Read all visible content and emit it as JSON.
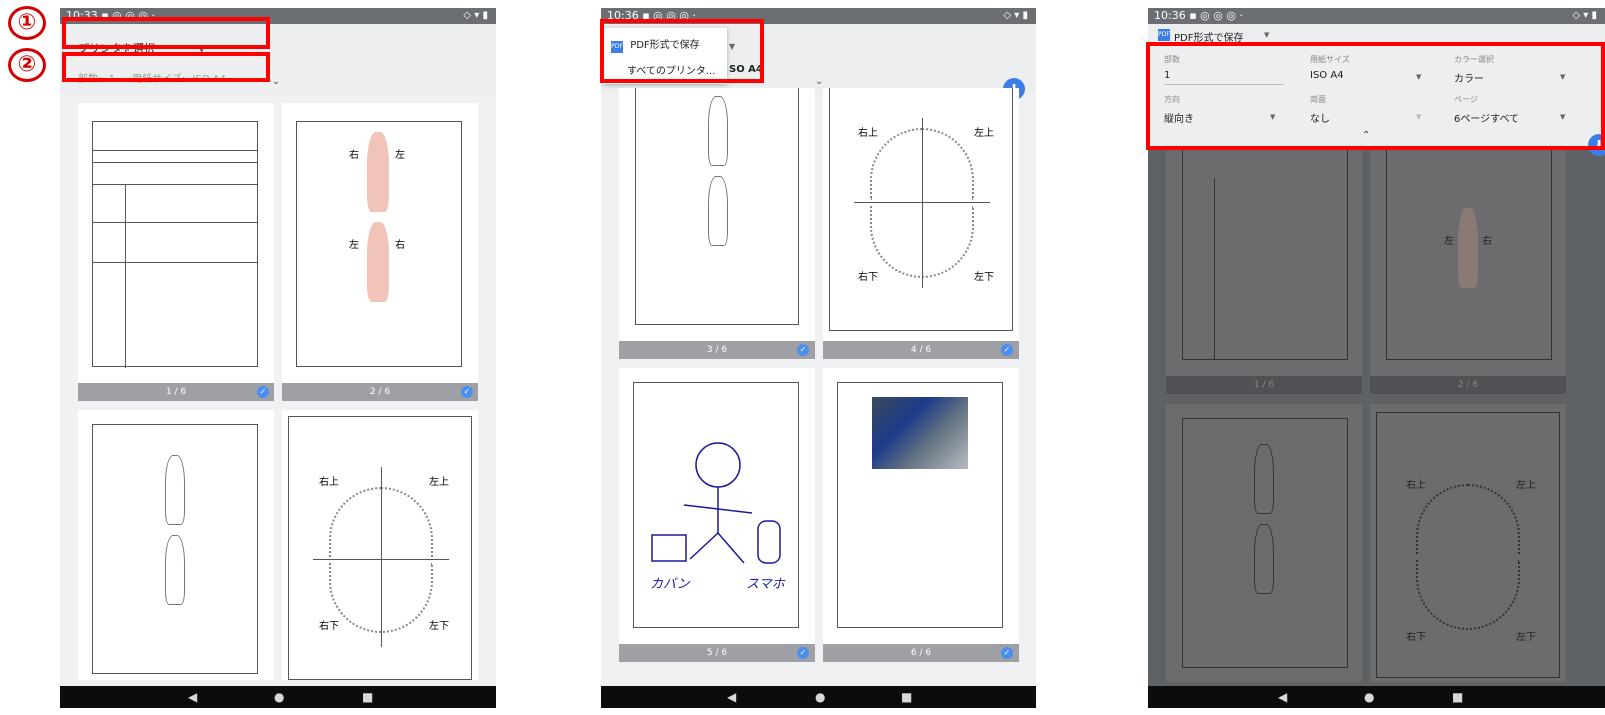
{
  "markers": {
    "one": "①",
    "two": "②"
  },
  "screen1": {
    "status_time": "10:33",
    "printer_select": "プリンタを選択",
    "summary": {
      "copies_label": "部数:",
      "copies": "1",
      "paper_label": "用紙サイズ:",
      "paper": "ISO A4"
    },
    "pages": [
      {
        "label": "1 / 6"
      },
      {
        "label": "2 / 6"
      }
    ],
    "body_labels": {
      "right": "右",
      "left": "左"
    },
    "teeth_labels": {
      "upper_right": "右上",
      "upper_left": "左上",
      "lower_right": "右下",
      "lower_left": "左下"
    }
  },
  "screen2": {
    "status_time": "10:36",
    "dropdown_selected": "PDF形式で保存",
    "dropdown_all": "すべてのプリンタ...",
    "paper_partial": "SO A4",
    "pages": [
      {
        "label": "3 / 6"
      },
      {
        "label": "4 / 6"
      },
      {
        "label": "5 / 6"
      },
      {
        "label": "6 / 6"
      }
    ],
    "handwriting": {
      "bag": "カバン",
      "phone": "スマホ"
    },
    "teeth_labels": {
      "upper_right": "右上",
      "upper_left": "左上",
      "lower_right": "右下",
      "lower_left": "左下"
    }
  },
  "screen3": {
    "status_time": "10:36",
    "printer": "PDF形式で保存",
    "copies_label": "部数",
    "copies_value": "1",
    "paper_label": "用紙サイズ",
    "paper_value": "ISO A4",
    "color_label": "カラー選択",
    "color_value": "カラー",
    "orientation_label": "方向",
    "orientation_value": "縦向き",
    "duplex_label": "両面",
    "duplex_value": "なし",
    "pages_label": "ページ",
    "pages_value": "6ページすべて",
    "page_labels": [
      "1 / 6",
      "2 / 6"
    ],
    "body_labels": {
      "left": "左",
      "right": "右"
    },
    "teeth_labels": {
      "upper_right": "右上",
      "upper_left": "左上",
      "lower_right": "右下",
      "lower_left": "左下"
    }
  },
  "nav": {
    "back": "◀",
    "home": "●",
    "recents": "■"
  },
  "colors": {
    "accent": "#4a8ef0",
    "highlight": "#ff0000"
  }
}
